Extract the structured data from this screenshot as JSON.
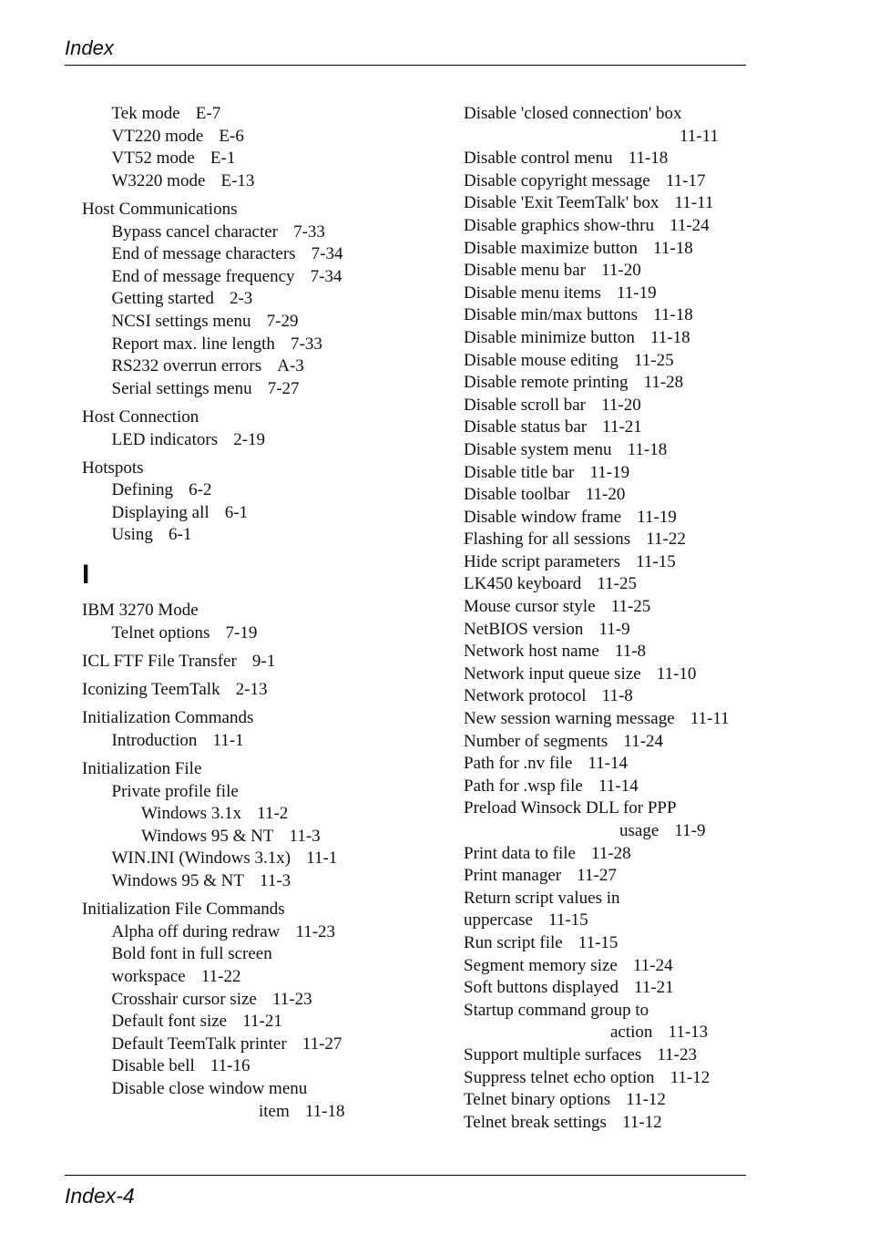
{
  "header": {
    "running_title": "Index"
  },
  "footer": {
    "page_number": "Index-4"
  },
  "left_column": {
    "continued_subentries": [
      {
        "text": "Tek mode",
        "page": "E-7"
      },
      {
        "text": "VT220 mode",
        "page": "E-6"
      },
      {
        "text": "VT52 mode",
        "page": "E-1"
      },
      {
        "text": "W3220 mode",
        "page": "E-13"
      }
    ],
    "host_communications": {
      "heading": "Host Communications",
      "items": [
        {
          "text": "Bypass cancel character",
          "page": "7-33"
        },
        {
          "text": "End of message characters",
          "page": "7-34"
        },
        {
          "text": "End of message frequency",
          "page": "7-34"
        },
        {
          "text": "Getting started",
          "page": "2-3"
        },
        {
          "text": "NCSI settings menu",
          "page": "7-29"
        },
        {
          "text": "Report max. line length",
          "page": "7-33"
        },
        {
          "text": "RS232 overrun errors",
          "page": "A-3"
        },
        {
          "text": "Serial settings menu",
          "page": "7-27"
        }
      ]
    },
    "host_connection": {
      "heading": "Host Connection",
      "items": [
        {
          "text": "LED indicators",
          "page": "2-19"
        }
      ]
    },
    "hotspots": {
      "heading": "Hotspots",
      "items": [
        {
          "text": "Defining",
          "page": "6-2"
        },
        {
          "text": "Displaying all",
          "page": "6-1"
        },
        {
          "text": "Using",
          "page": "6-1"
        }
      ]
    },
    "section_letter": "I",
    "ibm_3270": {
      "heading": "IBM 3270 Mode",
      "items": [
        {
          "text": "Telnet options",
          "page": "7-19"
        }
      ]
    },
    "icl_ftf": {
      "text": "ICL FTF File Transfer",
      "page": "9-1"
    },
    "iconizing": {
      "text": "Iconizing TeemTalk",
      "page": "2-13"
    },
    "init_commands": {
      "heading": "Initialization Commands",
      "items": [
        {
          "text": "Introduction",
          "page": "11-1"
        }
      ]
    },
    "init_file": {
      "heading": "Initialization File",
      "private_profile": {
        "heading": "Private profile file",
        "items": [
          {
            "text": "Windows 3.1x",
            "page": "11-2"
          },
          {
            "text": "Windows 95 & NT",
            "page": "11-3"
          }
        ]
      },
      "items": [
        {
          "text": "WIN.INI (Windows 3.1x)",
          "page": "11-1"
        },
        {
          "text": "Windows 95 & NT",
          "page": "11-3"
        }
      ]
    },
    "init_file_commands": {
      "heading": "Initialization File Commands",
      "items": [
        {
          "text": "Alpha off during redraw",
          "page": "11-23"
        },
        {
          "text": "Bold font in full screen",
          "cont": "workspace",
          "page": "11-22"
        },
        {
          "text": "Crosshair cursor size",
          "page": "11-23"
        },
        {
          "text": "Default font size",
          "page": "11-21"
        },
        {
          "text": "Default TeemTalk printer",
          "page": "11-27"
        },
        {
          "text": "Disable bell",
          "page": "11-16"
        },
        {
          "text": "Disable close window menu",
          "cont": "item",
          "page": "11-18"
        }
      ]
    }
  },
  "right_column": {
    "items": [
      {
        "text": "Disable 'closed connection' box",
        "page": "11-11",
        "wrap": "right"
      },
      {
        "text": "Disable control menu",
        "page": "11-18"
      },
      {
        "text": "Disable copyright message",
        "page": "11-17"
      },
      {
        "text": "Disable 'Exit TeemTalk' box",
        "page": "11-11"
      },
      {
        "text": "Disable graphics show-thru",
        "page": "11-24"
      },
      {
        "text": "Disable maximize button",
        "page": "11-18"
      },
      {
        "text": "Disable menu bar",
        "page": "11-20"
      },
      {
        "text": "Disable menu items",
        "page": "11-19"
      },
      {
        "text": "Disable min/max buttons",
        "page": "11-18"
      },
      {
        "text": "Disable minimize button",
        "page": "11-18"
      },
      {
        "text": "Disable mouse editing",
        "page": "11-25"
      },
      {
        "text": "Disable remote printing",
        "page": "11-28"
      },
      {
        "text": "Disable scroll bar",
        "page": "11-20"
      },
      {
        "text": "Disable status bar",
        "page": "11-21"
      },
      {
        "text": "Disable system menu",
        "page": "11-18"
      },
      {
        "text": "Disable title bar",
        "page": "11-19"
      },
      {
        "text": "Disable toolbar",
        "page": "11-20"
      },
      {
        "text": "Disable window frame",
        "page": "11-19"
      },
      {
        "text": "Flashing for all sessions",
        "page": "11-22"
      },
      {
        "text": "Hide script parameters",
        "page": "11-15"
      },
      {
        "text": "LK450 keyboard",
        "page": "11-25"
      },
      {
        "text": "Mouse cursor style",
        "page": "11-25"
      },
      {
        "text": "NetBIOS version",
        "page": "11-9"
      },
      {
        "text": "Network host name",
        "page": "11-8"
      },
      {
        "text": "Network input queue size",
        "page": "11-10"
      },
      {
        "text": "Network protocol",
        "page": "11-8"
      },
      {
        "text": "New session warning message",
        "page": "11-11"
      },
      {
        "text": "Number of segments",
        "page": "11-24"
      },
      {
        "text": "Path for .nv file",
        "page": "11-14"
      },
      {
        "text": "Path for .wsp file",
        "page": "11-14"
      },
      {
        "text": "Preload Winsock DLL for PPP",
        "cont": "usage",
        "page": "11-9",
        "wrap": "indent"
      },
      {
        "text": "Print data to file",
        "page": "11-28"
      },
      {
        "text": "Print manager",
        "page": "11-27"
      },
      {
        "text": "Return script values in",
        "cont": "uppercase",
        "page": "11-15",
        "wrap": "flush"
      },
      {
        "text": "Run script file",
        "page": "11-15"
      },
      {
        "text": "Segment memory size",
        "page": "11-24"
      },
      {
        "text": "Soft buttons displayed",
        "page": "11-21"
      },
      {
        "text": "Startup command group to",
        "cont": "action",
        "page": "11-13",
        "wrap": "indent"
      },
      {
        "text": "Support multiple surfaces",
        "page": "11-23"
      },
      {
        "text": "Suppress telnet echo option",
        "page": "11-12"
      },
      {
        "text": "Telnet binary options",
        "page": "11-12"
      },
      {
        "text": "Telnet break settings",
        "page": "11-12"
      }
    ]
  }
}
